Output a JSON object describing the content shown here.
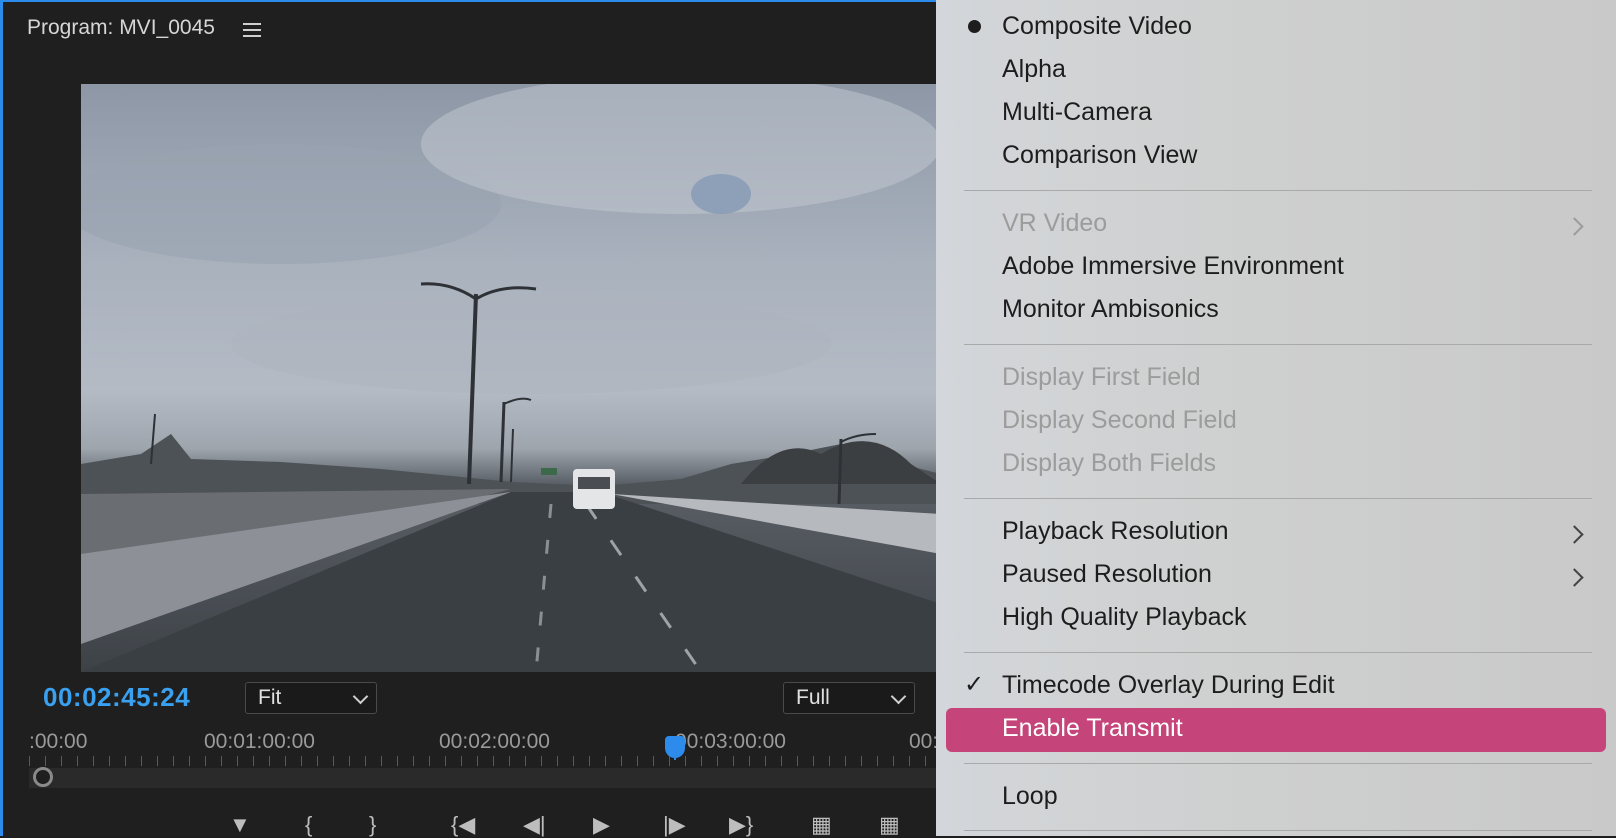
{
  "panel": {
    "title": "Program: MVI_0045",
    "timecode": "00:02:45:24",
    "zoom_select": "Fit",
    "resolution_select": "Full",
    "ruler_labels": [
      ":00:00",
      "00:01:00:00",
      "00:02:00:00",
      "00:03:00:00",
      "00:"
    ]
  },
  "menu": {
    "items": [
      {
        "label": "Composite Video",
        "state": "selected"
      },
      {
        "label": "Alpha"
      },
      {
        "label": "Multi-Camera"
      },
      {
        "label": "Comparison View"
      },
      {
        "label": "VR Video",
        "disabled": true,
        "submenu": true
      },
      {
        "label": "Adobe Immersive Environment"
      },
      {
        "label": "Monitor Ambisonics"
      },
      {
        "label": "Display First Field",
        "disabled": true
      },
      {
        "label": "Display Second Field",
        "disabled": true
      },
      {
        "label": "Display Both Fields",
        "disabled": true
      },
      {
        "label": "Playback Resolution",
        "submenu": true
      },
      {
        "label": "Paused Resolution",
        "submenu": true
      },
      {
        "label": "High Quality Playback"
      },
      {
        "label": "Timecode Overlay During Edit",
        "checked": true
      },
      {
        "label": "Enable Transmit",
        "highlighted": true
      },
      {
        "label": "Loop"
      }
    ],
    "highlight_color": "#c5457a"
  },
  "colors": {
    "accent": "#2d8ceb",
    "timecode": "#3aa0f0"
  }
}
